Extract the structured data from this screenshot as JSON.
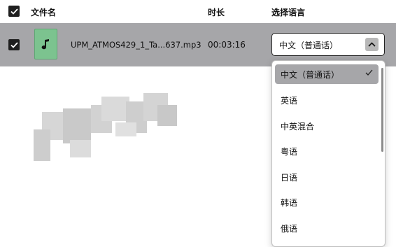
{
  "header": {
    "file_name_label": "文件名",
    "duration_label": "时长",
    "language_label": "选择语言"
  },
  "row": {
    "file_name": "UPM_ATMOS429_1_Ta...637.mp3",
    "duration": "00:03:16",
    "selected_language": "中文（普通话）",
    "file_icon": "music-note-icon"
  },
  "dropdown": {
    "options": [
      {
        "label": "中文（普通话）",
        "selected": true
      },
      {
        "label": "英语",
        "selected": false
      },
      {
        "label": "中英混合",
        "selected": false
      },
      {
        "label": "粤语",
        "selected": false
      },
      {
        "label": "日语",
        "selected": false
      },
      {
        "label": "韩语",
        "selected": false
      },
      {
        "label": "俄语",
        "selected": false
      }
    ]
  },
  "colors": {
    "selected_row_bg": "#a6a6a9",
    "file_icon_bg": "#7cc38f",
    "checkbox_bg": "#1f1f1f"
  }
}
